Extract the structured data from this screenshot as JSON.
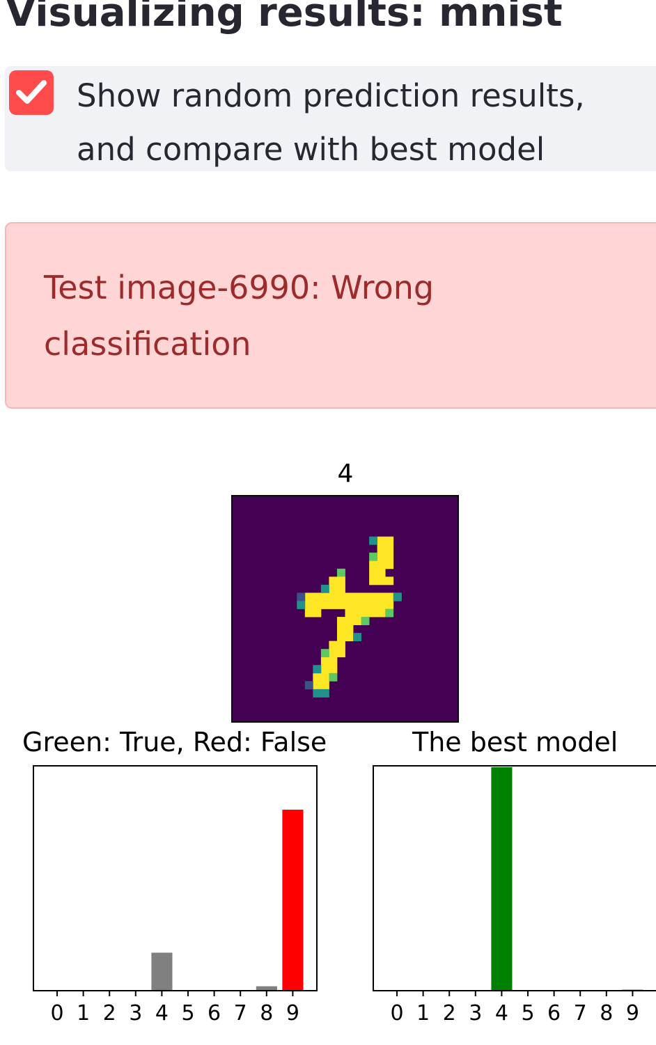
{
  "page": {
    "title": "Visualizing results: mnist"
  },
  "checkbox": {
    "checked": true,
    "label": "Show random prediction results, and compare with best model"
  },
  "alert": {
    "message": "Test image-6990: Wrong classification"
  },
  "colors": {
    "accent": "#ff4b4b",
    "alert_bg": "#ffd5d5",
    "alert_text": "#9d2b2b",
    "bar_default": "#808080",
    "bar_true": "#008000",
    "bar_false": "#ff0000",
    "image_background": "#440154"
  },
  "chart_data": [
    {
      "type": "image",
      "title": "4",
      "colormap": "viridis",
      "size": [
        28,
        28
      ]
    },
    {
      "type": "bar",
      "title": "Green: True, Red: False",
      "categories": [
        "0",
        "1",
        "2",
        "3",
        "4",
        "5",
        "6",
        "7",
        "8",
        "9"
      ],
      "values": [
        0,
        0,
        0,
        0,
        0.17,
        0,
        0,
        0,
        0.02,
        0.81
      ],
      "bar_colors": [
        "#808080",
        "#808080",
        "#808080",
        "#808080",
        "#808080",
        "#808080",
        "#808080",
        "#808080",
        "#808080",
        "#ff0000"
      ],
      "ylim": [
        0,
        1
      ],
      "grid": false
    },
    {
      "type": "bar",
      "title": "The best model",
      "categories": [
        "0",
        "1",
        "2",
        "3",
        "4",
        "5",
        "6",
        "7",
        "8",
        "9"
      ],
      "values": [
        0,
        0,
        0,
        0,
        1.0,
        0,
        0,
        0,
        0,
        0.005
      ],
      "bar_colors": [
        "#808080",
        "#808080",
        "#808080",
        "#808080",
        "#008000",
        "#808080",
        "#808080",
        "#808080",
        "#808080",
        "#808080"
      ],
      "ylim": [
        0,
        1
      ],
      "grid": false
    }
  ]
}
